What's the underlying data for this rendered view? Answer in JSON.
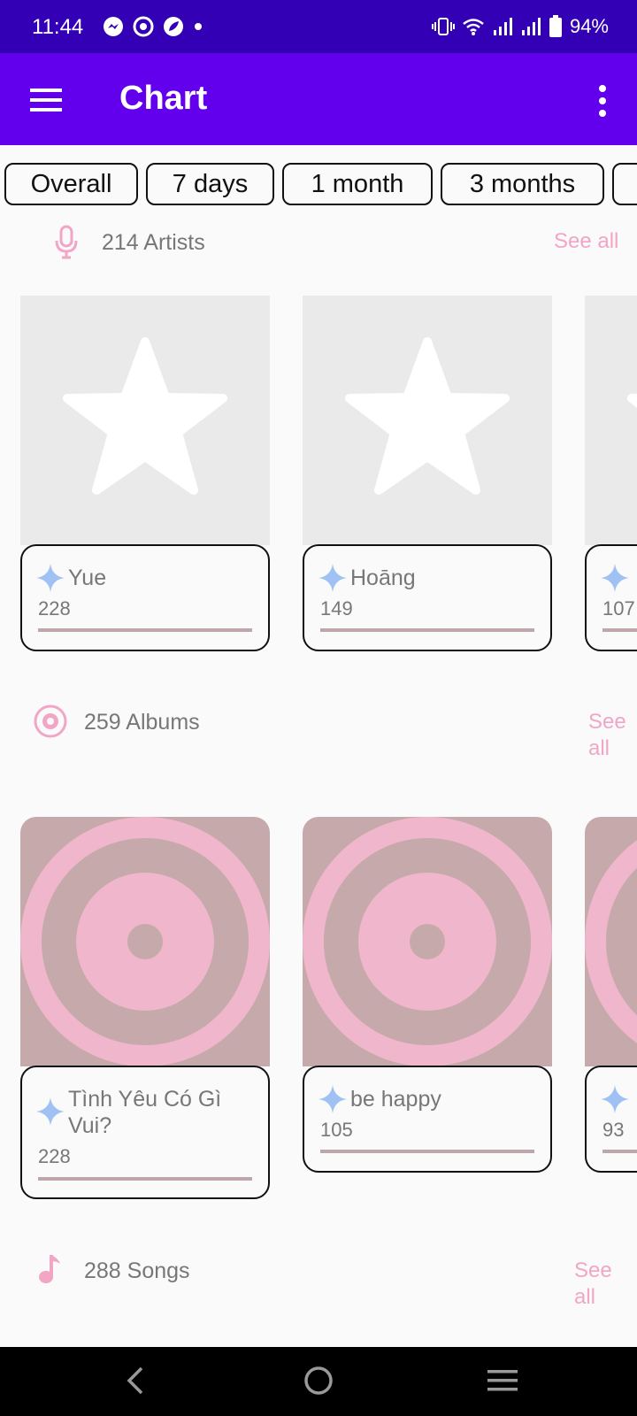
{
  "status_bar": {
    "time": "11:44",
    "battery": "94%"
  },
  "app_bar": {
    "title": "Chart"
  },
  "filters": [
    "Overall",
    "7 days",
    "1 month",
    "3 months"
  ],
  "artists": {
    "title": "214 Artists",
    "see_all": "See all",
    "items": [
      {
        "name": "Yue",
        "count": "228"
      },
      {
        "name": "Hoāng",
        "count": "149"
      },
      {
        "name": "",
        "count": "107"
      }
    ]
  },
  "albums": {
    "title": "259 Albums",
    "see_all_1": "See",
    "see_all_2": "all",
    "items": [
      {
        "name": "Tình Yêu Có Gì Vui?",
        "count": "228"
      },
      {
        "name": "be happy",
        "count": "105"
      },
      {
        "name": "",
        "count": "93"
      }
    ]
  },
  "songs": {
    "title": "288 Songs",
    "see_all_1": "See",
    "see_all_2": "all"
  },
  "colors": {
    "status_bar": "#3300b5",
    "app_bar": "#6200ee",
    "accent_pink": "#f2a6c6",
    "album_bg": "#c6a9aa",
    "sparkle": "#9fc1f3"
  }
}
